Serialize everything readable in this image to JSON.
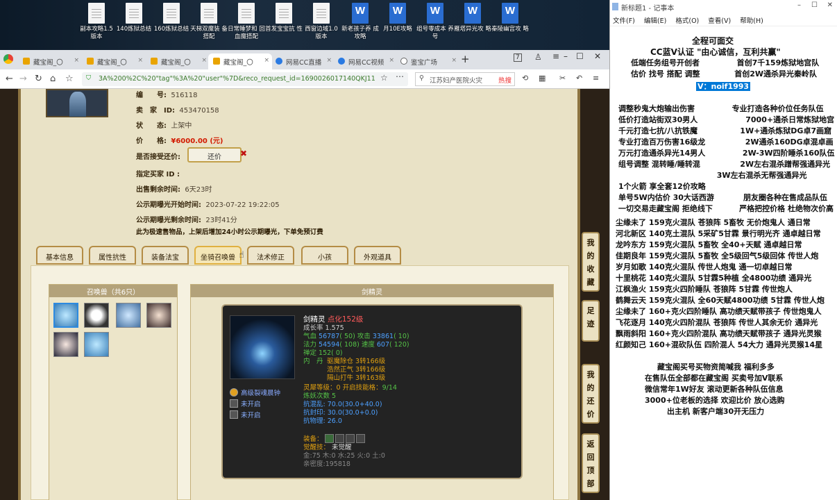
{
  "desktop": {
    "icons": [
      {
        "label": "副本攻略1.5 版本",
        "kind": "doc"
      },
      {
        "label": "140炼狱总结",
        "kind": "doc"
      },
      {
        "label": "160炼狱总结",
        "kind": "doc"
      },
      {
        "label": "天梯双魔装 备搭配",
        "kind": "doc"
      },
      {
        "label": "日常睡梦和 回血魔搭配",
        "kind": "doc"
      },
      {
        "label": "首发宝宝抗 性",
        "kind": "doc"
      },
      {
        "label": "西窗边域1.0 版本",
        "kind": "doc"
      },
      {
        "label": "新老孩子养 成攻略",
        "kind": "word"
      },
      {
        "label": "月10E攻略",
        "kind": "word"
      },
      {
        "label": "组号零成本 养号",
        "kind": "word"
      },
      {
        "label": "雁塔异光攻 略",
        "kind": "word"
      },
      {
        "label": "秦陵幽宫攻 略",
        "kind": "word"
      }
    ]
  },
  "browser": {
    "tabs": [
      {
        "label": "藏宝阁_〇",
        "active": false,
        "icon_color": "#e9a400"
      },
      {
        "label": "藏宝阁_〇",
        "active": false,
        "icon_color": "#e9a400"
      },
      {
        "label": "藏宝阁_〇",
        "active": false,
        "icon_color": "#e9a400"
      },
      {
        "label": "藏宝阁_〇",
        "active": true,
        "icon_color": "#e9a400"
      },
      {
        "label": "网易CC直播",
        "active": false,
        "icon_color": "#2a7ae2"
      },
      {
        "label": "网易CC视频",
        "active": false,
        "icon_color": "#2a7ae2"
      },
      {
        "label": "鉴宝广场",
        "active": false,
        "icon_color": "#666666"
      }
    ],
    "new_tab": "+",
    "url": "3A%200%2C%20\"tag\"%3A%20\"user\"%7D&reco_request_id=1690026017140QKJ11",
    "search_placeholder": "江苏妇产医院火灾",
    "search_hot": "热搜",
    "tab_count": "7"
  },
  "item": {
    "number_label": "编　　号:",
    "number": "516118",
    "seller_label": "卖　家　ID:",
    "seller_id": "453470158",
    "status_label": "状　　态:",
    "status": "上架中",
    "price_label": "价　　格:",
    "price": "¥6000.00 (元)",
    "counter_label": "是否接受还价:",
    "counter_button": "还价",
    "buyer_label": "指定买家 ID :",
    "remain_label": "出售剩余时间:",
    "remain": "6天23时",
    "public_start_label": "公示期曝光开始时间:",
    "public_start": "2023-07-22 19:22:05",
    "public_remain_label": "公示期曝光剩余时间:",
    "public_remain": "23时41分",
    "notice": "此为极速售物品，上架后增加24小时公示期曝光，下单免预订费"
  },
  "detail_tabs": [
    "基本信息",
    "属性抗性",
    "装备法宝",
    "坐骑召唤兽",
    "法术修正",
    "小孩",
    "外观道具"
  ],
  "active_detail_tab": 3,
  "pet_list": {
    "header": "召唤兽（共6只）"
  },
  "pet": {
    "header": "剑精灵",
    "name": "剑精灵",
    "bonus": "点化152级",
    "growth": "成长率 1.575",
    "hp_line": [
      "气血 ",
      "56787",
      "( 50) 攻击 ",
      "33861",
      "( 10)"
    ],
    "mp_line": [
      "法力 ",
      "54594",
      "( 108) 速度 ",
      "607",
      "( 120)"
    ],
    "calm": "禅定 152( 0)",
    "inner_label": "内　丹",
    "inner1": "驱魔除仓 3转166级",
    "inner2": "浩然正气 3转166级",
    "inner3": "隔山打牛 3转163级",
    "spirit_line": [
      "灵犀等级：0 开启技能格：",
      "9/14"
    ],
    "refine": "炼妖次数 5",
    "res1": "抗混乱: 70.0(30.0+40.0)",
    "res2": "抗封印: 30.0(30.0+0.0)",
    "res3": "抗物理: 26.0",
    "skill1": "高级裂魂晨钟",
    "skill2": "未开启",
    "skill3": "未开启",
    "equip_label": "装备：",
    "awaken_label": "觉醒技：",
    "awaken": "未觉醒",
    "elements": "金:75 木:0 水:25 火:0 土:0",
    "affection": "亲密度:195818"
  },
  "side_menu": [
    {
      "label": "我的收藏"
    },
    {
      "label": "足迹"
    },
    {
      "label": "我的还价"
    },
    {
      "label": "返回顶部"
    }
  ],
  "notepad": {
    "title": "新标题1 - 记事本",
    "menu": [
      "文件(F)",
      "编辑(E)",
      "格式(O)",
      "查看(V)",
      "帮助(H)"
    ],
    "lines": [
      "全程可面交",
      "CC蓝V认证 \"由心诚信，互利共赢\"",
      "低端任务组号开创者              首创7千159炼狱地宫队",
      "估价 找号 搭配 调整             首创2W通杀异光秦岭队",
      "V：noif1993",
      "调整秒鬼大炮输出伤害              专业打造各种价位任务队伍",
      "低价打造站街双30男人                  7000+通杀日常炼狱地宫",
      "千元打造七抗/八抗铁魔                1W+通杀炼狱DG卓7画窟",
      "专业打造百万伤害16级龙               2W通杀160DG卓混卓画",
      "万元打造通杀异光14男人              2W-3W四阶睡杀160队伍",
      "组号调整 混转睡/睡转混               2W左右混杀蹭帮强通异光",
      "                                     3W左右混杀无帮强通异光",
      "1个火箭 享全套12价攻略",
      "单号5W内估价 30大话西游           朋友圈各种在售成品队伍",
      "一切交易走藏宝阁 拒绝线下          严格把控价格 杜绝物次价高",
      "尘缘未了 159克火混队 苍狼阵 5畜牧 无价炮鬼人 通日常",
      "河北新区 140克土混队 5采矿5甘霖 景行明光齐 通卓越日常",
      "龙吟东方 159克火混队 5畜牧 全40+天赋 通卓越日常",
      "佳期良年 159克火混队 5畜牧 全5级回气5级回体 传世人炮",
      "岁月如歌 140克火混队 传世人炮鬼 通一切卓越日常",
      "十里桃花 140克火混队 5甘霖5种植 全4800功绩 通异光",
      "江枫渔火 159克火四阶睡队 苍狼阵 5甘霖 传世炮人",
      "鹤舞云天 159克火混队 全60天赋4800功绩 5甘霖 传世人炮",
      "尘缘未了 160+克火四阶睡队 高功绩天赋带孩子 传世炮鬼人",
      "飞花逐月 140克火四阶混队 苍狼阵 传世人其余无价 通异光",
      "飘雨斜阳 160+克火四阶混队 高功绩天赋带孩子 通异光灵猴",
      "红颜知己 160+混砍队伍 四阶混人 54大力 通异光灵猴14星",
      "藏宝阁买号买物资简喊我 福利多多",
      "在售队伍全部都在藏宝阁 买卖号加V联系",
      "微信常年1W好友 滚动更新各种队伍信息",
      "3000+位老板的选择 欢迎比价 放心选购",
      "出主机 新客户端30开无压力"
    ]
  }
}
